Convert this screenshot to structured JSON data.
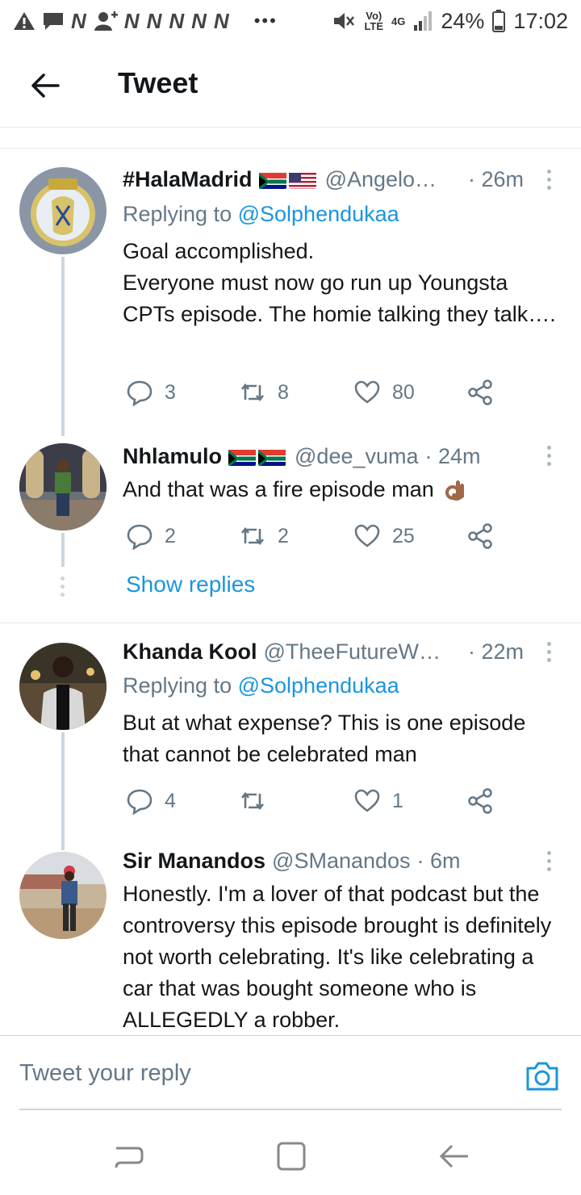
{
  "status_bar": {
    "left_icons": [
      "alert-icon",
      "message-icon",
      "n-icon",
      "person-add-icon",
      "n-icon",
      "n-icon",
      "n-icon",
      "n-icon",
      "n-icon"
    ],
    "n_glyph": "N",
    "dots": "•••",
    "volte": "Vo)\nLTE",
    "network": "4G",
    "battery": "24%",
    "time": "17:02"
  },
  "header": {
    "title": "Tweet"
  },
  "tweets": [
    {
      "name": "#HalaMadrid",
      "flags": [
        "za",
        "us"
      ],
      "handle": "@Angelo…",
      "time": "· 26m",
      "replying_label": "Replying to",
      "replying_to": "@Solphendukaa",
      "body": "Goal accomplished.\nEveryone must now go run up Youngsta CPTs episode. The homie talking they talk….",
      "replies": "3",
      "retweets": "8",
      "likes": "80"
    },
    {
      "name": "Nhlamulo",
      "flags": [
        "za",
        "za"
      ],
      "handle": "@dee_vuma",
      "time": "· 24m",
      "body": "And that was a fire episode man",
      "emoji": "👌🏽",
      "replies": "2",
      "retweets": "2",
      "likes": "25"
    },
    {
      "name": "Khanda Kool",
      "handle": "@TheeFutureW…",
      "time": "· 22m",
      "replying_label": "Replying to",
      "replying_to": "@Solphendukaa",
      "body": "But at what expense? This is one episode that cannot be celebrated man",
      "replies": "4",
      "retweets": "",
      "likes": "1"
    },
    {
      "name": "Sir Manandos",
      "handle": "@SManandos",
      "time": "· 6m",
      "body": "Honestly. I'm a lover of that podcast but the controversy this episode brought is definitely not worth celebrating. It's like celebrating a car that was bought someone who is ALLEGEDLY a robber."
    }
  ],
  "show_replies": "Show replies",
  "compose": {
    "placeholder": "Tweet your reply"
  },
  "colors": {
    "accent": "#1b95e0",
    "secondary_text": "#657786",
    "divider": "#e1e8ed"
  }
}
